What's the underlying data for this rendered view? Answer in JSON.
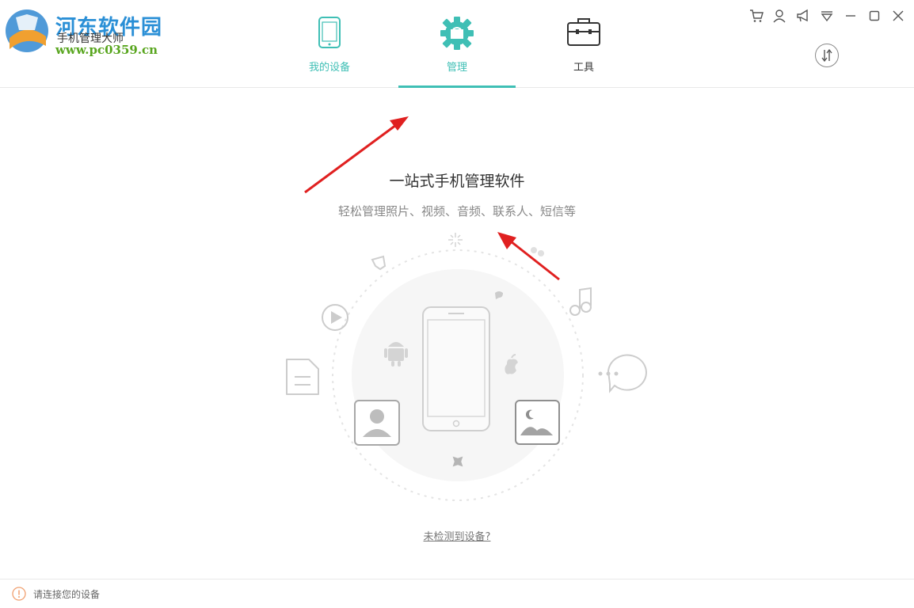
{
  "app": {
    "name": "手机管理大师",
    "watermark_title": "河东软件园",
    "watermark_url": "www.pc0359.cn"
  },
  "tabs": [
    {
      "label": "我的设备",
      "icon": "phone-icon"
    },
    {
      "label": "管理",
      "icon": "gear-icon",
      "active": true
    },
    {
      "label": "工具",
      "icon": "toolbox-icon"
    }
  ],
  "window_controls": [
    "cart-icon",
    "user-icon",
    "megaphone-icon",
    "dropdown-icon",
    "minimize-icon",
    "maximize-icon",
    "close-icon"
  ],
  "main": {
    "headline": "一站式手机管理软件",
    "subline": "轻松管理照片、视频、音频、联系人、短信等",
    "help_link": "未检测到设备?"
  },
  "status": {
    "text": "请连接您的设备"
  },
  "colors": {
    "accent": "#3fbfb5",
    "annotation_arrow": "#e02020"
  }
}
